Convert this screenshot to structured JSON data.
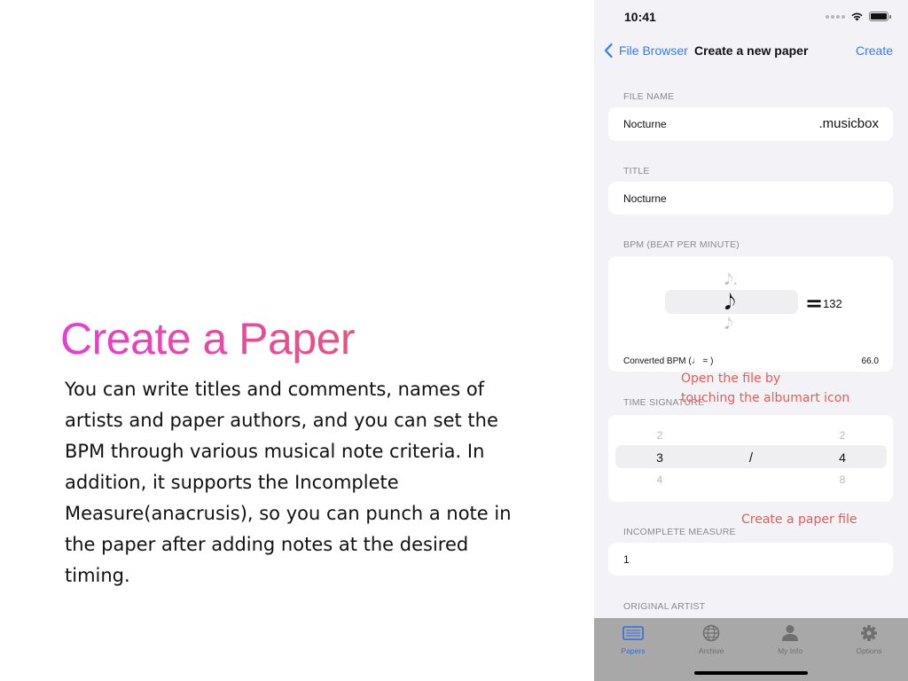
{
  "promo": {
    "title": "Create a Paper",
    "body": "You can write titles and comments, names of artists and paper authors, and you can set the BPM through various musical note criteria. In addition, it supports the Incomplete Measure(anacrusis), so you can punch a note in the paper after adding notes at the desired timing."
  },
  "status_bar": {
    "time": "10:41"
  },
  "nav": {
    "back_label": "File Browser",
    "title": "Create a new paper",
    "create_label": "Create"
  },
  "file_name": {
    "label": "FILE NAME",
    "value": "Nocturne",
    "extension": ".musicbox"
  },
  "title_field": {
    "label": "TITLE",
    "value": "Nocturne"
  },
  "bpm": {
    "label": "BPM (BEAT PER MINUTE)",
    "notes": [
      "𝅘𝅥𝅮.",
      "𝅘𝅥𝅮",
      "𝅘𝅥𝅮"
    ],
    "equals": "=",
    "value": "132",
    "converted_label": "Converted BPM (♩ = )",
    "converted_value": "66.0"
  },
  "time_signature": {
    "label": "TIME SIGNATURE",
    "numerator": {
      "above": "2",
      "selected": "3",
      "below": "4"
    },
    "separator": "/",
    "denominator": {
      "above": "2",
      "selected": "4",
      "below": "8"
    }
  },
  "incomplete_measure": {
    "label": "INCOMPLETE MEASURE",
    "value": "1"
  },
  "original_artist": {
    "label": "ORIGINAL ARTIST"
  },
  "annotations": {
    "open_file": [
      "Open the file by",
      "touching the albumart icon"
    ],
    "create_file": "Create a paper file"
  },
  "tabs": [
    {
      "label": "Papers",
      "icon": "papers-icon",
      "active": true
    },
    {
      "label": "Archive",
      "icon": "globe-icon",
      "active": false
    },
    {
      "label": "My Info",
      "icon": "person-icon",
      "active": false
    },
    {
      "label": "Options",
      "icon": "gear-icon",
      "active": false
    }
  ],
  "colors": {
    "accent": "#2f7ef6",
    "annotation": "#e85c55",
    "title_gradient": [
      "#e63fd1",
      "#ea4f88",
      "#e8634f"
    ]
  }
}
